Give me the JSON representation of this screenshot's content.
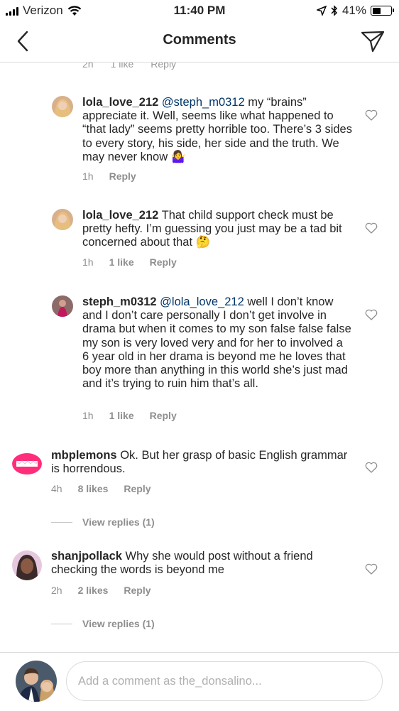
{
  "status": {
    "carrier": "Verizon",
    "time": "11:40 PM",
    "battery": "41%"
  },
  "header": {
    "title": "Comments",
    "back_icon": "chevron-left-icon",
    "send_icon": "paper-plane-icon"
  },
  "cutoff": {
    "time": "2h",
    "likes": "1 like",
    "reply": "Reply"
  },
  "comments": [
    {
      "username": "lola_love_212",
      "mention": "@steph_m0312",
      "text": " my “brains” appreciate it. Well, seems like what happened to “that lady” seems pretty horrible too. There’s 3 sides to every story, his side, her side and the truth. We may never know 🤷‍♀️",
      "time": "1h",
      "likes": "",
      "reply": "Reply"
    },
    {
      "username": "lola_love_212",
      "mention": "",
      "text": " That child support check must be pretty hefty. I’m guessing you just may be a tad bit concerned about that 🤔",
      "time": "1h",
      "likes": "1 like",
      "reply": "Reply"
    },
    {
      "username": "steph_m0312",
      "mention": "@lola_love_212",
      "text": " well I don’t know and I don’t care personally I don’t get involve in drama but when it comes to my son false false false my son is very loved very and for her to involved a 6 year old in her drama is beyond me he loves that boy more than anything in this world she’s just mad and it’s trying to ruin him that’s all.",
      "time": "1h",
      "likes": "1 like",
      "reply": "Reply"
    },
    {
      "username": "mbplemons",
      "mention": "",
      "text": " Ok. But her grasp of basic English grammar is horrendous.",
      "time": "4h",
      "likes": "8 likes",
      "reply": "Reply",
      "view_replies": "View replies (1)"
    },
    {
      "username": "shanjpollack",
      "mention": "",
      "text": " Why she would post without a friend checking the words is beyond me",
      "time": "2h",
      "likes": "2 likes",
      "reply": "Reply",
      "view_replies": "View replies (1)"
    }
  ],
  "composer": {
    "placeholder": "Add a comment as the_donsalino..."
  },
  "colors": {
    "mention": "#003569",
    "meta": "#8e8e8e",
    "divider": "#dbdbdb"
  }
}
